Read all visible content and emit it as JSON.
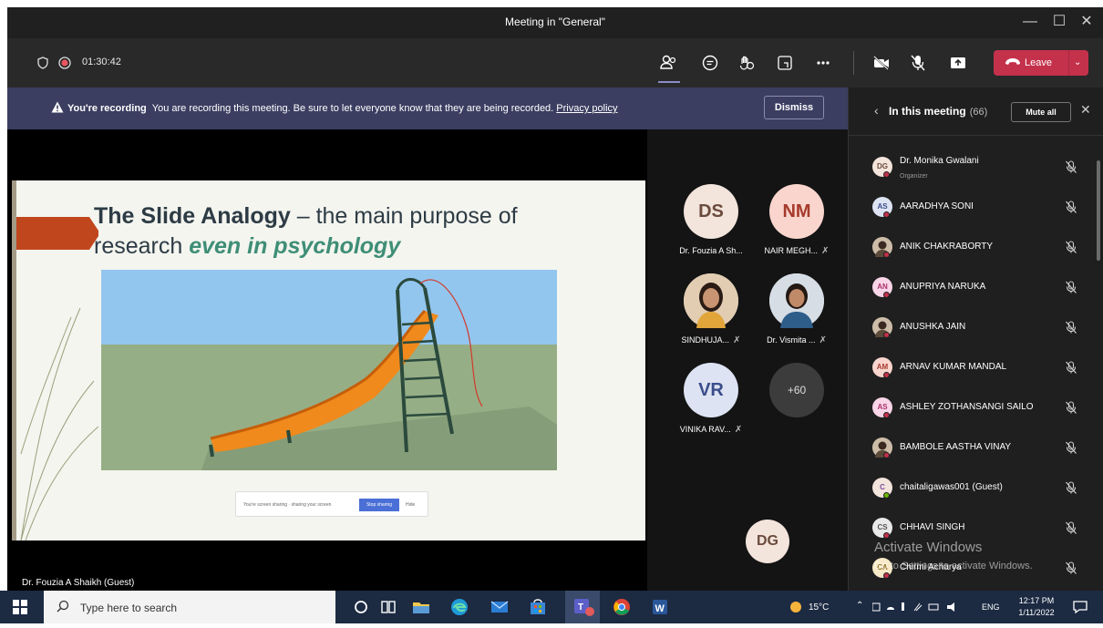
{
  "window": {
    "title": "Meeting in \"General\"",
    "controls": [
      "—",
      "☐",
      "✕"
    ]
  },
  "toolbar": {
    "timer": "01:30:42",
    "leave_label": "Leave"
  },
  "banner": {
    "heading": "You're recording",
    "message": "You are recording this meeting. Be sure to let everyone know that they are being recorded.",
    "link": "Privacy policy",
    "dismiss_label": "Dismiss"
  },
  "stage": {
    "slide": {
      "title_bold": "The Slide Analogy",
      "title_rest": " – the main purpose of",
      "line2_plain": "research ",
      "line2_emph": "even in psychology"
    },
    "share_notice": {
      "text": "You're screen sharing · sharing your screen",
      "stop_label": "Stop sharing",
      "hide_label": "Hide"
    },
    "presenter": "Dr. Fouzia A Shaikh (Guest)",
    "tiles": [
      {
        "initials": "DS",
        "name": "Dr. Fouzia A Sh..."
      },
      {
        "initials": "NM",
        "name": "NAIR MEGH..."
      },
      {
        "initials": "",
        "name": "SINDHUJA..."
      },
      {
        "initials": "",
        "name": "Dr. Vismita ..."
      },
      {
        "initials": "VR",
        "name": "VINIKA RAV..."
      },
      {
        "initials": "+60",
        "name": ""
      }
    ],
    "self_initials": "DG"
  },
  "panel": {
    "title": "In this meeting",
    "count": "(66)",
    "mute_all_label": "Mute all",
    "participants": [
      {
        "initials": "DG",
        "name": "Dr. Monika Gwalani",
        "role": "Organizer"
      },
      {
        "initials": "AS",
        "name": "AARADHYA SONI"
      },
      {
        "initials": "",
        "name": "ANIK CHAKRABORTY"
      },
      {
        "initials": "AN",
        "name": "ANUPRIYA NARUKA"
      },
      {
        "initials": "",
        "name": "ANUSHKA JAIN"
      },
      {
        "initials": "AM",
        "name": "ARNAV KUMAR MANDAL"
      },
      {
        "initials": "AS",
        "name": "ASHLEY ZOTHANSANGI SAILO"
      },
      {
        "initials": "",
        "name": "BAMBOLE AASTHA VINAY"
      },
      {
        "initials": "C",
        "name": "chaitaligawas001 (Guest)"
      },
      {
        "initials": "CS",
        "name": "CHHAVI SINGH"
      },
      {
        "initials": "CA",
        "name": "Chirmi Acharya"
      }
    ],
    "watermark_title": "Activate Windows",
    "watermark_sub": "Go to Settings to activate Windows."
  },
  "taskbar": {
    "search_placeholder": "Type here to search",
    "weather": "15°C",
    "lang": "ENG",
    "time": "12:17 PM",
    "date": "1/11/2022"
  },
  "colors": {
    "leave": "#c4314b",
    "banner": "#3b3e61",
    "accent": "#6264a7"
  }
}
